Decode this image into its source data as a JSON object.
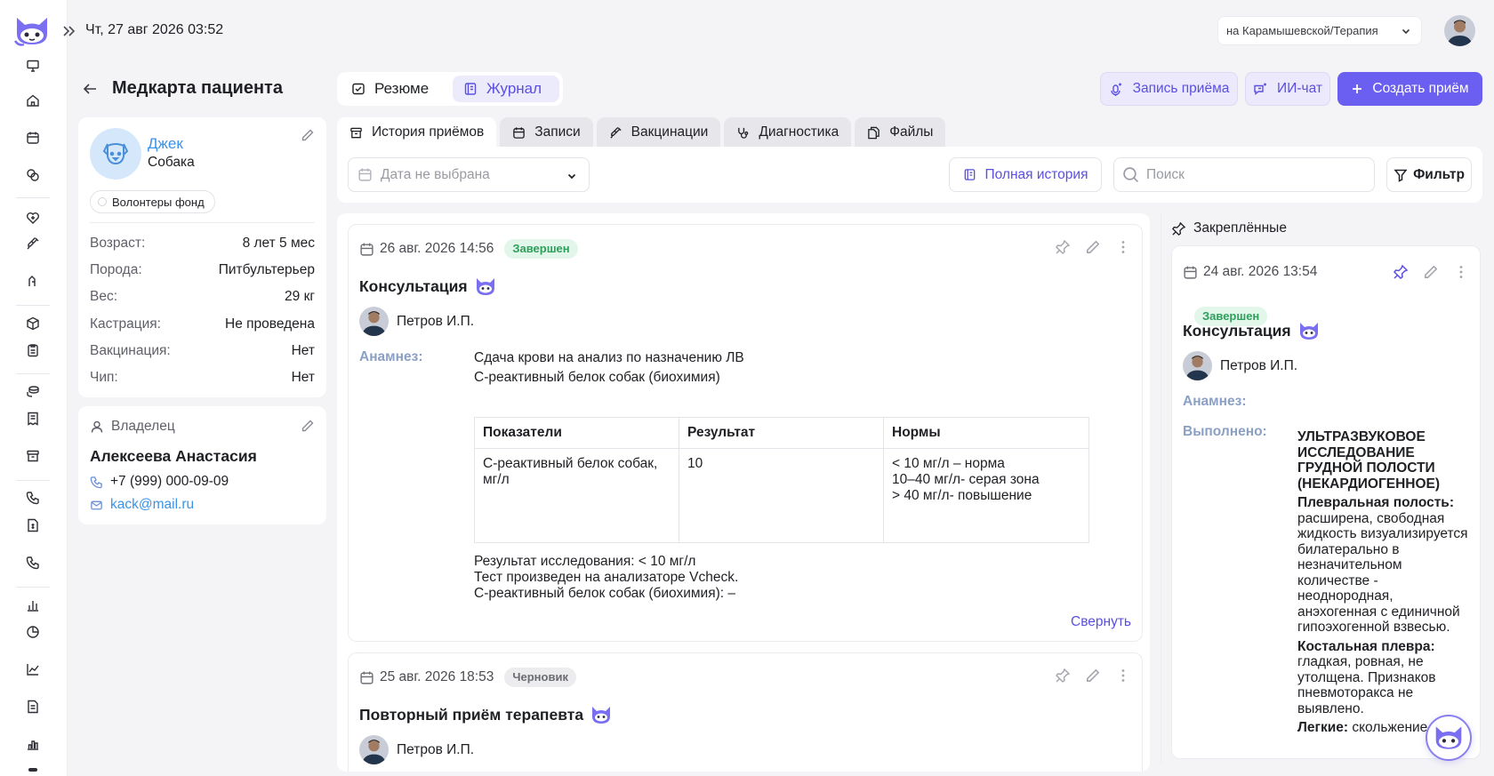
{
  "topbar": {
    "datetime": "Чт,  27 авг 2026 03:52",
    "branch": "на Карамышевской/Терапия"
  },
  "header": {
    "title": "Медкарта пациента",
    "views": [
      {
        "label": "Резюме",
        "active": false
      },
      {
        "label": "Журнал",
        "active": true
      }
    ],
    "record_button": "Запись приёма",
    "ai_chat_button": "ИИ-чат",
    "create_button": "Создать приём"
  },
  "patient": {
    "name": "Джек",
    "species": "Собака",
    "tag": "Волонтеры фонд",
    "fields": [
      {
        "label": "Возраст:",
        "value": "8 лет 5 мес"
      },
      {
        "label": "Порода:",
        "value": "Питбультерьер"
      },
      {
        "label": "Вес:",
        "value": "29 кг"
      },
      {
        "label": "Кастрация:",
        "value": "Не проведена"
      },
      {
        "label": "Вакцинация:",
        "value": "Нет"
      },
      {
        "label": "Чип:",
        "value": "Нет"
      }
    ]
  },
  "owner": {
    "label": "Владелец",
    "name": "Алексеева Анастасия",
    "phone": "+7 (999) 000-09-09",
    "email": "kack@mail.ru"
  },
  "tabs": [
    {
      "label": "История приёмов",
      "active": true
    },
    {
      "label": "Записи",
      "active": false
    },
    {
      "label": "Вакцинации",
      "active": false
    },
    {
      "label": "Диагностика",
      "active": false
    },
    {
      "label": "Файлы",
      "active": false
    }
  ],
  "filters": {
    "date_placeholder": "Дата не выбрана",
    "full_history": "Полная история",
    "search_placeholder": "Поиск",
    "filter_button": "Фильтр"
  },
  "visits": [
    {
      "datetime": "26 авг. 2026 14:56",
      "status": "Завершен",
      "title": "Консультация",
      "doctor": "Петров И.П.",
      "anamnesis_label": "Анамнез:",
      "anamnesis": [
        "Сдача крови на анализ по назначению ЛВ",
        "С-реактивный белок собак (биохимия)"
      ],
      "table": {
        "headers": [
          "Показатели",
          "Результат",
          "Нормы"
        ],
        "row": [
          "С-реактивный белок собак, мг/л",
          "10",
          [
            "< 10 мг/л – норма",
            "10–40 мг/л- серая зона",
            "> 40 мг/л- повышение"
          ]
        ]
      },
      "results": [
        "Результат исследования: < 10 мг/л",
        "Тест произведен на анализаторе Vcheck.",
        "С-реактивный белок собак (биохимия): –"
      ],
      "collapse": "Свернуть"
    },
    {
      "datetime": "25 авг. 2026 18:53",
      "status": "Черновик",
      "title": "Повторный приём терапевта",
      "doctor": "Петров И.П."
    }
  ],
  "pinned": {
    "label": "Закреплённые",
    "datetime": "24 авг. 2026 13:54",
    "status": "Завершен",
    "title": "Консультация",
    "doctor": "Петров И.П.",
    "anamnesis_label": "Анамнез:",
    "done_label": "Выполнено:",
    "procedure": "УЛЬТРАЗВУКОВОЕ ИССЛЕДОВАНИЕ ГРУДНОЙ ПОЛОСТИ (НЕКАРДИОГЕННОЕ)",
    "sections": [
      {
        "title": "Плевральная полость:",
        "text": "расширена, свободная жидкость визуализируется билатерально в незначительном количестве - неоднородная, анэхогенная с единичной гипоэхогенной взвесью."
      },
      {
        "title": "Костальная плевра:",
        "text": "гладкая, ровная, не утолщена. Признаков пневмоторакса не выявлено."
      },
      {
        "title": "Легкие:",
        "text": "скольжение"
      }
    ]
  },
  "colors": {
    "accent": "#6a5ff0",
    "link": "#3b93e6",
    "success": "#2f9f5c"
  }
}
